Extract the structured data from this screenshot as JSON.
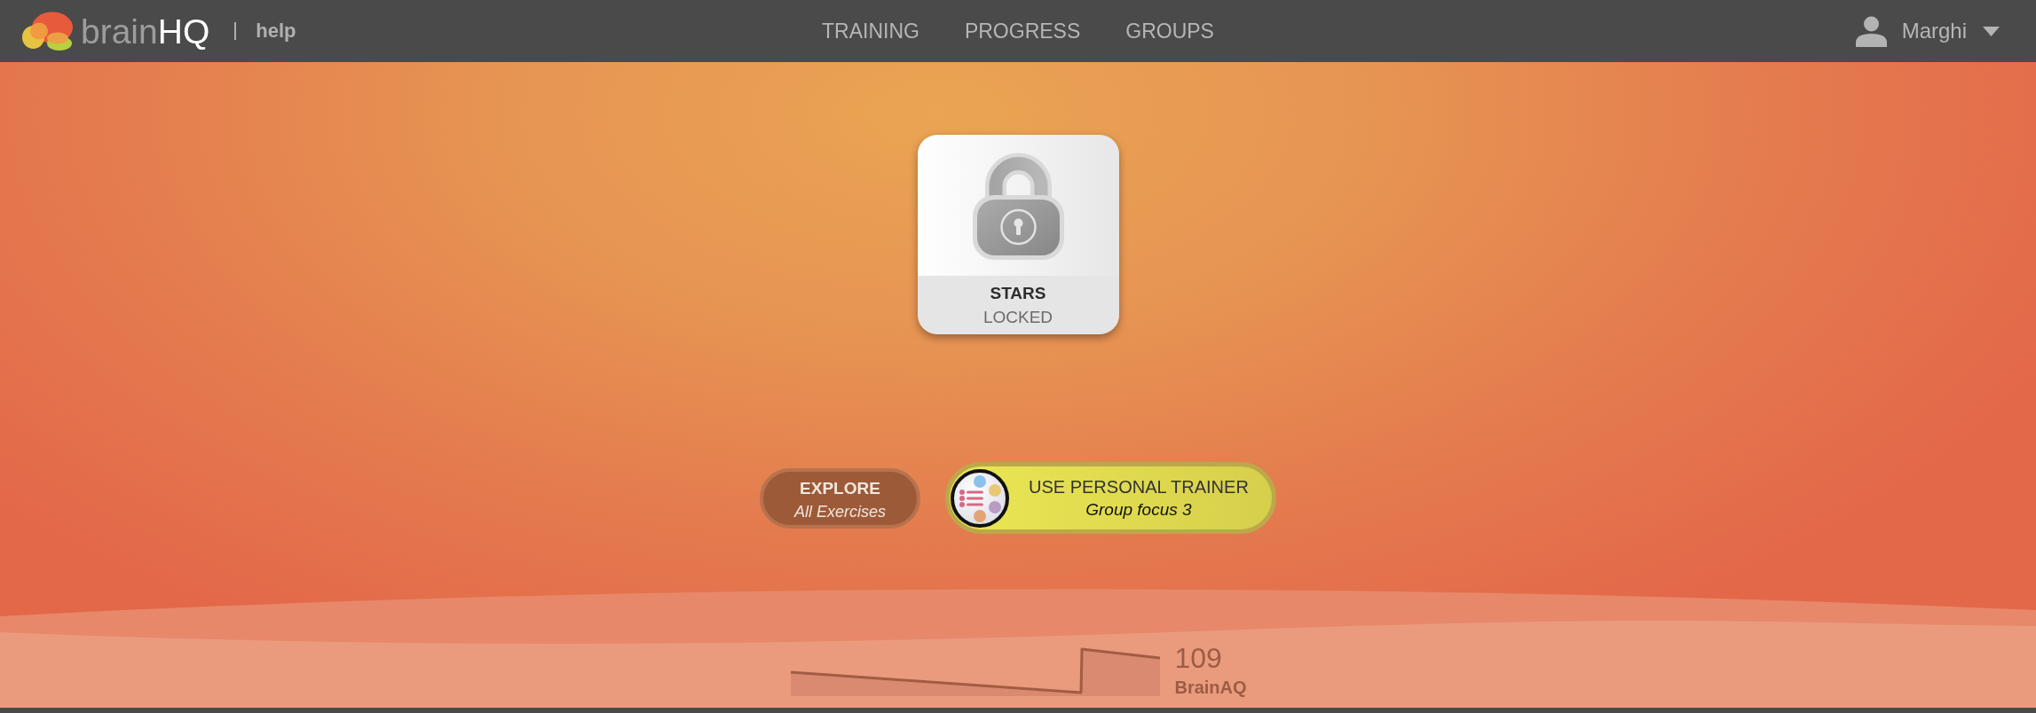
{
  "header": {
    "logo": {
      "brand_start": "brain",
      "brand_end": "HQ"
    },
    "help_link": "help",
    "nav": [
      {
        "label": "TRAINING"
      },
      {
        "label": "PROGRESS"
      },
      {
        "label": "GROUPS"
      }
    ],
    "user": {
      "name": "Marghi"
    }
  },
  "tile": {
    "title": "STARS",
    "status": "LOCKED",
    "locked": true
  },
  "buttons": [
    {
      "kind": "explore",
      "title": "EXPLORE",
      "subtitle": "All Exercises"
    },
    {
      "kind": "personal_trainer",
      "title": "USE PERSONAL TRAINER",
      "subtitle": "Group focus 3"
    }
  ],
  "brainaq": {
    "score": "109",
    "label": "BrainAQ"
  }
}
